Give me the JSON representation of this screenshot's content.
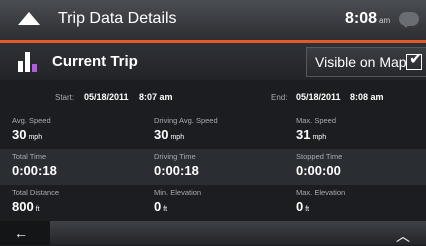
{
  "titlebar": {
    "title": "Trip Data Details",
    "time": "8:08",
    "ampm": "am"
  },
  "header": {
    "trip_title": "Current Trip",
    "visible_on_map_label": "Visible on Map",
    "visible_checked": true,
    "check_glyph": "✔"
  },
  "dates": {
    "start_label": "Start:",
    "start_date": "05/18/2011",
    "start_time": "8:07 am",
    "end_label": "End:",
    "end_date": "05/18/2011",
    "end_time": "8:08 am"
  },
  "stats": [
    [
      {
        "label": "Avg. Speed",
        "value": "30",
        "unit": "mph"
      },
      {
        "label": "Driving Avg. Speed",
        "value": "30",
        "unit": "mph"
      },
      {
        "label": "Max. Speed",
        "value": "31",
        "unit": "mph"
      }
    ],
    [
      {
        "label": "Total Time",
        "value": "0:00:18",
        "unit": ""
      },
      {
        "label": "Driving Time",
        "value": "0:00:18",
        "unit": ""
      },
      {
        "label": "Stopped Time",
        "value": "0:00:00",
        "unit": ""
      }
    ],
    [
      {
        "label": "Total Distance",
        "value": "800",
        "unit": "ft"
      },
      {
        "label": "Min. Elevation",
        "value": "0",
        "unit": "ft"
      },
      {
        "label": "Max. Elevation",
        "value": "0",
        "unit": "ft"
      }
    ]
  ],
  "bottom": {
    "back_glyph": "←",
    "up_glyph": "︿"
  },
  "colors": {
    "accent": "#e45a2a",
    "trip_icon_highlight": "#b05ce0"
  },
  "icons": {
    "back": "back-arrow-icon",
    "up": "chevron-up-icon",
    "message": "message-icon",
    "menu": "up-triangle-icon"
  }
}
